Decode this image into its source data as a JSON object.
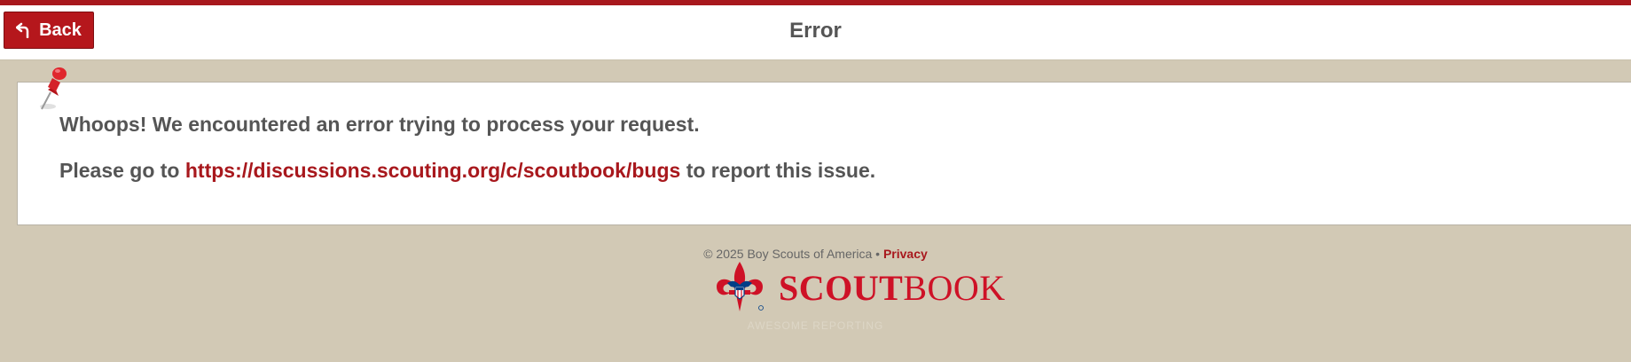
{
  "header": {
    "back_label": "Back",
    "title": "Error"
  },
  "error": {
    "line1": "Whoops! We encountered an error trying to process your request.",
    "line2_prefix": "Please go to ",
    "link": "https://discussions.scouting.org/c/scoutbook/bugs",
    "line2_suffix": " to report this issue."
  },
  "footer": {
    "copyright": "© 2025 Boy Scouts of America • ",
    "privacy": "Privacy",
    "logo_bold": "SCOUT",
    "logo_light": "BOOK",
    "tagline": "AWESOME REPORTING"
  },
  "colors": {
    "accent": "#a8181d",
    "background": "#d2c9b5",
    "text": "#555555"
  },
  "icons": [
    "back-arrow-icon",
    "pushpin-icon",
    "bsa-fleur-de-lis-logo"
  ]
}
